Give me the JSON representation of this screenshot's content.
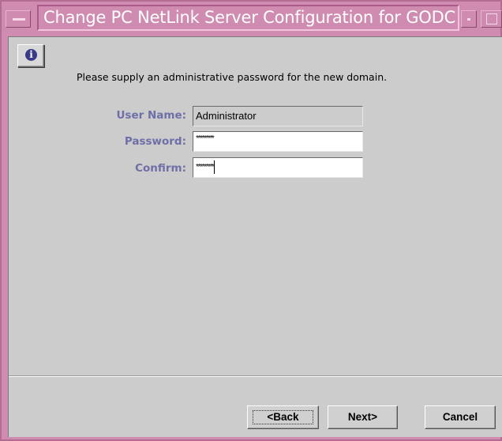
{
  "window": {
    "title": "Change PC NetLink Server Configuration for GODC"
  },
  "icons": {
    "window_menu": "window-menu-icon",
    "minimize": "minimize-icon",
    "maximize": "maximize-icon",
    "info": "info-icon"
  },
  "info": {
    "glyph": "i"
  },
  "dialog": {
    "instruction": "Please supply an administrative password for the new domain."
  },
  "form": {
    "username": {
      "label": "User Name:",
      "value": "Administrator"
    },
    "password": {
      "label": "Password:",
      "value": "*********"
    },
    "confirm": {
      "label": "Confirm:",
      "value": "*********"
    }
  },
  "buttons": {
    "back": "<Back",
    "next": "Next>",
    "cancel": "Cancel"
  },
  "colors": {
    "title_bar": "#cf8cb0",
    "label_text": "#6f6fa8",
    "dialog_background": "#cccccc"
  }
}
